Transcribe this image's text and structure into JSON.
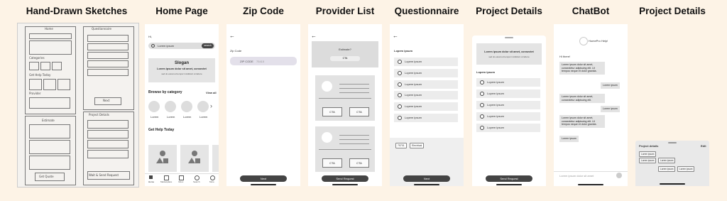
{
  "titles": [
    "Hand-Drawn Sketches",
    "Home Page",
    "Zip Code",
    "Provider List",
    "Questionnaire",
    "Project Details",
    "ChatBot",
    "Project Details"
  ],
  "sketch": {
    "labels": [
      "Home",
      "Questionnaire",
      "Categories",
      "Get Help Today",
      "Provider",
      "Estimate",
      "Provider List",
      "Project Details",
      "Get Quote",
      "Next",
      "Wait & Send Request"
    ]
  },
  "home": {
    "greeting": "Hi,",
    "search_placeholder": "Lorem ipsum",
    "search_button": "search",
    "slogan": "Slogan",
    "slogan_sub": "Lorem ipsum dolor sit amet, consectet",
    "slogan_small": "sed do eiusmod tempor incididunt ut labore",
    "browse_title": "Browse by category",
    "browse_link": "View all",
    "categories": [
      "Lorem",
      "Lorem",
      "Lorem",
      "Lorem"
    ],
    "help_title": "Get Help Today",
    "nav": [
      "Home",
      "Marketplace",
      "Inbox",
      "Search",
      "More"
    ]
  },
  "zip": {
    "label": "Zip Code",
    "field_prefix": "ZIP CODE",
    "field_value": "75415",
    "button": "Next"
  },
  "provider": {
    "estimate": "Estimate?",
    "estimate_cta": "CTA",
    "cta": "CTA",
    "button": "Send Request"
  },
  "questionnaire": {
    "heading": "Lopem ipsum",
    "options": [
      "Lopem ipsum",
      "Lopem ipsum",
      "Lopem ipsum",
      "Lopem ipsum",
      "Lopem ipsum",
      "Lopem ipsum"
    ],
    "chips": [
      "75701",
      "Electrical"
    ],
    "button": "Next"
  },
  "details": {
    "banner": "Lorem ipsum dolor sit amet, consectet",
    "banner_sub": "sed do eiusmod tempor incididunt ut labore",
    "heading": "Lopem ipsum",
    "options": [
      "Lopem ipsum",
      "Lopem ipsum",
      "Lopem ipsum",
      "Lopem ipsum",
      "Lopem ipsum"
    ],
    "button": "Send Request"
  },
  "chat": {
    "bot_name": "HomePro Help!",
    "greeting": "Hi there!",
    "msg1": "Lorem ipsum dolor sit amet, consectetur adipiscing elit. Ut tempus neque et dolor gravida.",
    "reply1": "Lorem ipsum",
    "msg2": "Lorem ipsum dolor sit amet, consectetur adipiscing elit.",
    "reply2": "Lorem ipsum",
    "msg3": "Lorem ipsum dolor sit amet, consectetur adipiscing elit. Ut tempus neque et dolor gravida.",
    "msg4": "Lorem ipsum",
    "input_placeholder": "Lorem ipsum dolor sit amet"
  },
  "details2": {
    "title": "Project details",
    "edit": "Edit",
    "chips": [
      "Lorem ipsum",
      "Lorem ipsum",
      "Lorem ipsum",
      "Lorem ipsum",
      "Lorem ipsum"
    ]
  }
}
